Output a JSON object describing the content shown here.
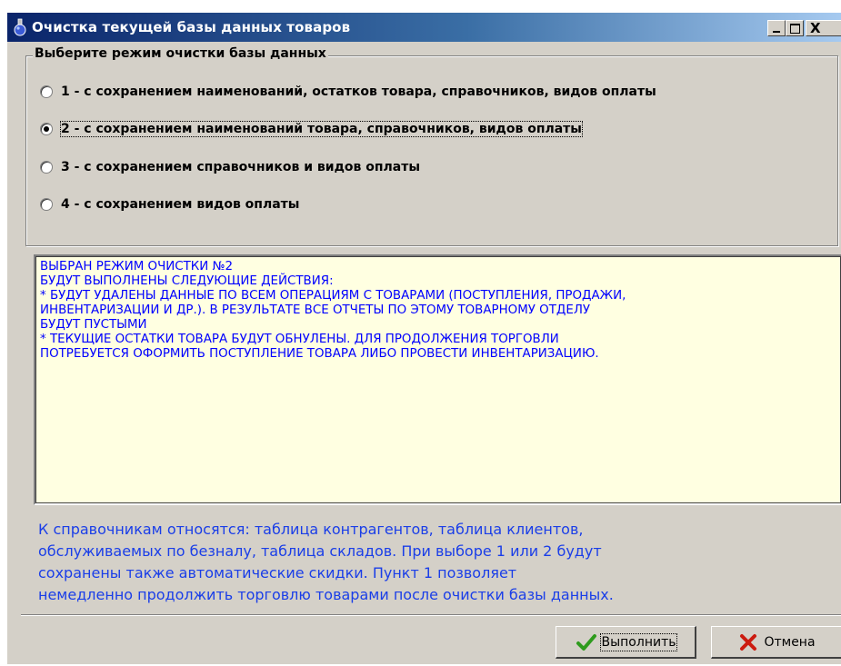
{
  "window": {
    "title": "Очистка текущей базы данных товаров",
    "controls": {
      "minimize": "_",
      "maximize": "□",
      "close": "X"
    }
  },
  "mode_group": {
    "legend": "Выберите режим очистки базы данных",
    "options": [
      {
        "label": "1 - с сохранением наименований, остатков товара, справочников, видов оплаты",
        "selected": false
      },
      {
        "label": "2 - с сохранением наименований товара, справочников, видов оплаты",
        "selected": true
      },
      {
        "label": "3 - с сохранением справочников и видов оплаты",
        "selected": false
      },
      {
        "label": "4 - с сохранением видов оплаты",
        "selected": false
      }
    ]
  },
  "description": {
    "lines": [
      "ВЫБРАН РЕЖИМ ОЧИСТКИ №2",
      "БУДУТ ВЫПОЛНЕНЫ СЛЕДУЮЩИЕ ДЕЙСТВИЯ:",
      "* БУДУТ УДАЛЕНЫ ДАННЫЕ ПО ВСЕМ ОПЕРАЦИЯМ С ТОВАРАМИ (ПОСТУПЛЕНИЯ, ПРОДАЖИ,",
      "ИНВЕНТАРИЗАЦИИ И ДР.). В РЕЗУЛЬТАТЕ ВСЕ ОТЧЕТЫ ПО ЭТОМУ ТОВАРНОМУ ОТДЕЛУ",
      "БУДУТ ПУСТЫМИ",
      "* ТЕКУЩИЕ ОСТАТКИ ТОВАРА БУДУТ ОБНУЛЕНЫ. ДЛЯ ПРОДОЛЖЕНИЯ ТОРГОВЛИ",
      "ПОТРЕБУЕТСЯ ОФОРМИТЬ ПОСТУПЛЕНИЕ ТОВАРА ЛИБО ПРОВЕСТИ ИНВЕНТАРИЗАЦИЮ."
    ]
  },
  "info": {
    "lines": [
      "К справочникам относятся: таблица контрагентов, таблица клиентов,",
      "обслуживаемых по безналу, таблица складов. При выборе 1 или 2 будут",
      "сохранены также автоматические скидки. Пункт 1 позволяет",
      "немедленно продолжить торговлю товарами после очистки базы данных."
    ]
  },
  "buttons": {
    "execute": "Выполнить",
    "cancel": "Отмена"
  },
  "icons": {
    "title": "flask-icon",
    "execute": "checkmark-icon",
    "cancel": "cross-icon"
  },
  "colors": {
    "titlebar_start": "#0a246a",
    "titlebar_end": "#a6caf0",
    "memo_background": "#ffffe1",
    "memo_text": "#0000ff",
    "info_text": "#1a3ee8",
    "execute_check": "#2e9b1d",
    "cancel_cross": "#cc1b0f"
  }
}
